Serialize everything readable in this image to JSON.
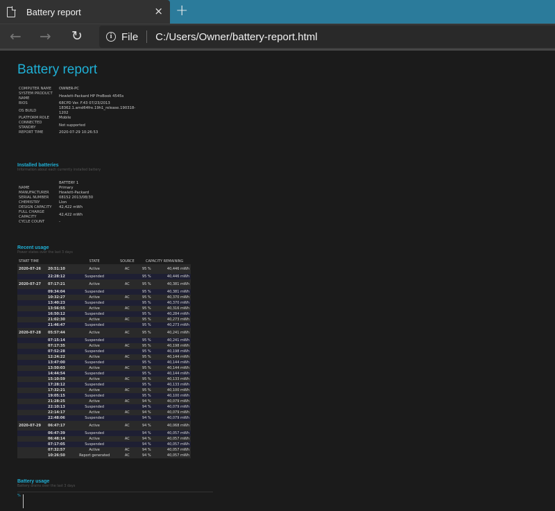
{
  "browser": {
    "tab_title": "Battery report",
    "close_label": "×",
    "new_tab_label": "+",
    "back_label": "←",
    "forward_label": "→",
    "reload_label": "↻",
    "info_label": "i",
    "scheme": "File",
    "url": "C:/Users/Owner/battery-report.html"
  },
  "report": {
    "title": "Battery report",
    "system": [
      {
        "key": "COMPUTER NAME",
        "value": "OWNER-PC"
      },
      {
        "key": "SYSTEM PRODUCT NAME",
        "value": "Hewlett-Packard HP ProBook 4545s"
      },
      {
        "key": "BIOS",
        "value": "68CPD Ver. F.43 07/23/2013"
      },
      {
        "key": "OS BUILD",
        "value": "18362.1.amd64fre.19h1_release.190318-1202"
      },
      {
        "key": "PLATFORM ROLE",
        "value": "Mobile"
      },
      {
        "key": "CONNECTED STANDBY",
        "value": "Not supported"
      },
      {
        "key": "REPORT TIME",
        "value": "2020-07-29   10:26:53"
      }
    ],
    "installed": {
      "title": "Installed batteries",
      "subtitle": "Information about each currently installed battery",
      "column": "BATTERY 1",
      "rows": [
        {
          "key": "NAME",
          "value": "Primary"
        },
        {
          "key": "MANUFACTURER",
          "value": "Hewlett-Packard"
        },
        {
          "key": "SERIAL NUMBER",
          "value": "08152 2013/08/30"
        },
        {
          "key": "CHEMISTRY",
          "value": "LIon"
        },
        {
          "key": "DESIGN CAPACITY",
          "value": "42,422 mWh"
        },
        {
          "key": "FULL CHARGE CAPACITY",
          "value": "42,422 mWh"
        },
        {
          "key": "CYCLE COUNT",
          "value": "-"
        }
      ]
    },
    "recent": {
      "title": "Recent usage",
      "subtitle": "Power states over the last 3 days",
      "headers": [
        "START TIME",
        "STATE",
        "SOURCE",
        "CAPACITY REMAINING"
      ],
      "rows": [
        {
          "date": "2020-07-26",
          "time": "20:51:10",
          "state": "Active",
          "source": "AC",
          "pct": "95 %",
          "cap": "40,446 mWh"
        },
        {
          "date": "",
          "time": "22:28:12",
          "state": "Suspended",
          "source": "",
          "pct": "95 %",
          "cap": "40,446 mWh"
        },
        {
          "date": "2020-07-27",
          "time": "07:17:21",
          "state": "Active",
          "source": "AC",
          "pct": "95 %",
          "cap": "40,381 mWh"
        },
        {
          "date": "",
          "time": "09:34:04",
          "state": "Suspended",
          "source": "",
          "pct": "95 %",
          "cap": "40,381 mWh"
        },
        {
          "date": "",
          "time": "10:32:27",
          "state": "Active",
          "source": "AC",
          "pct": "95 %",
          "cap": "40,370 mWh"
        },
        {
          "date": "",
          "time": "13:40:23",
          "state": "Suspended",
          "source": "",
          "pct": "95 %",
          "cap": "40,370 mWh"
        },
        {
          "date": "",
          "time": "13:56:55",
          "state": "Active",
          "source": "AC",
          "pct": "95 %",
          "cap": "40,316 mWh"
        },
        {
          "date": "",
          "time": "16:50:12",
          "state": "Suspended",
          "source": "",
          "pct": "95 %",
          "cap": "40,284 mWh"
        },
        {
          "date": "",
          "time": "21:02:30",
          "state": "Active",
          "source": "AC",
          "pct": "95 %",
          "cap": "40,273 mWh"
        },
        {
          "date": "",
          "time": "21:46:47",
          "state": "Suspended",
          "source": "",
          "pct": "95 %",
          "cap": "40,273 mWh"
        },
        {
          "date": "2020-07-28",
          "time": "05:57:44",
          "state": "Active",
          "source": "AC",
          "pct": "95 %",
          "cap": "40,241 mWh"
        },
        {
          "date": "",
          "time": "07:15:14",
          "state": "Suspended",
          "source": "",
          "pct": "95 %",
          "cap": "40,241 mWh"
        },
        {
          "date": "",
          "time": "07:17:35",
          "state": "Active",
          "source": "AC",
          "pct": "95 %",
          "cap": "40,198 mWh"
        },
        {
          "date": "",
          "time": "07:52:28",
          "state": "Suspended",
          "source": "",
          "pct": "95 %",
          "cap": "40,198 mWh"
        },
        {
          "date": "",
          "time": "12:24:22",
          "state": "Active",
          "source": "AC",
          "pct": "95 %",
          "cap": "40,144 mWh"
        },
        {
          "date": "",
          "time": "13:47:00",
          "state": "Suspended",
          "source": "",
          "pct": "95 %",
          "cap": "40,144 mWh"
        },
        {
          "date": "",
          "time": "13:50:03",
          "state": "Active",
          "source": "AC",
          "pct": "95 %",
          "cap": "40,144 mWh"
        },
        {
          "date": "",
          "time": "14:44:54",
          "state": "Suspended",
          "source": "",
          "pct": "95 %",
          "cap": "40,144 mWh"
        },
        {
          "date": "",
          "time": "15:10:59",
          "state": "Active",
          "source": "AC",
          "pct": "95 %",
          "cap": "40,133 mWh"
        },
        {
          "date": "",
          "time": "17:28:12",
          "state": "Suspended",
          "source": "",
          "pct": "95 %",
          "cap": "40,133 mWh"
        },
        {
          "date": "",
          "time": "17:32:21",
          "state": "Active",
          "source": "AC",
          "pct": "95 %",
          "cap": "40,100 mWh"
        },
        {
          "date": "",
          "time": "19:05:15",
          "state": "Suspended",
          "source": "",
          "pct": "95 %",
          "cap": "40,100 mWh"
        },
        {
          "date": "",
          "time": "21:28:25",
          "state": "Active",
          "source": "AC",
          "pct": "94 %",
          "cap": "40,079 mWh"
        },
        {
          "date": "",
          "time": "22:10:13",
          "state": "Suspended",
          "source": "",
          "pct": "94 %",
          "cap": "40,079 mWh"
        },
        {
          "date": "",
          "time": "22:14:17",
          "state": "Active",
          "source": "AC",
          "pct": "94 %",
          "cap": "40,079 mWh"
        },
        {
          "date": "",
          "time": "22:48:06",
          "state": "Suspended",
          "source": "",
          "pct": "94 %",
          "cap": "40,079 mWh"
        },
        {
          "date": "2020-07-29",
          "time": "06:47:17",
          "state": "Active",
          "source": "AC",
          "pct": "94 %",
          "cap": "40,068 mWh"
        },
        {
          "date": "",
          "time": "06:47:39",
          "state": "Suspended",
          "source": "",
          "pct": "94 %",
          "cap": "40,057 mWh"
        },
        {
          "date": "",
          "time": "06:48:14",
          "state": "Active",
          "source": "AC",
          "pct": "94 %",
          "cap": "40,057 mWh"
        },
        {
          "date": "",
          "time": "07:17:05",
          "state": "Suspended",
          "source": "",
          "pct": "94 %",
          "cap": "40,057 mWh"
        },
        {
          "date": "",
          "time": "07:32:57",
          "state": "Active",
          "source": "AC",
          "pct": "94 %",
          "cap": "40,057 mWh"
        },
        {
          "date": "",
          "time": "10:26:50",
          "state": "Report generated",
          "source": "AC",
          "pct": "94 %",
          "cap": "40,057 mWh"
        }
      ]
    },
    "usage": {
      "title": "Battery usage",
      "subtitle": "Battery drains over the last 3 days",
      "axis_tick": "%"
    }
  }
}
